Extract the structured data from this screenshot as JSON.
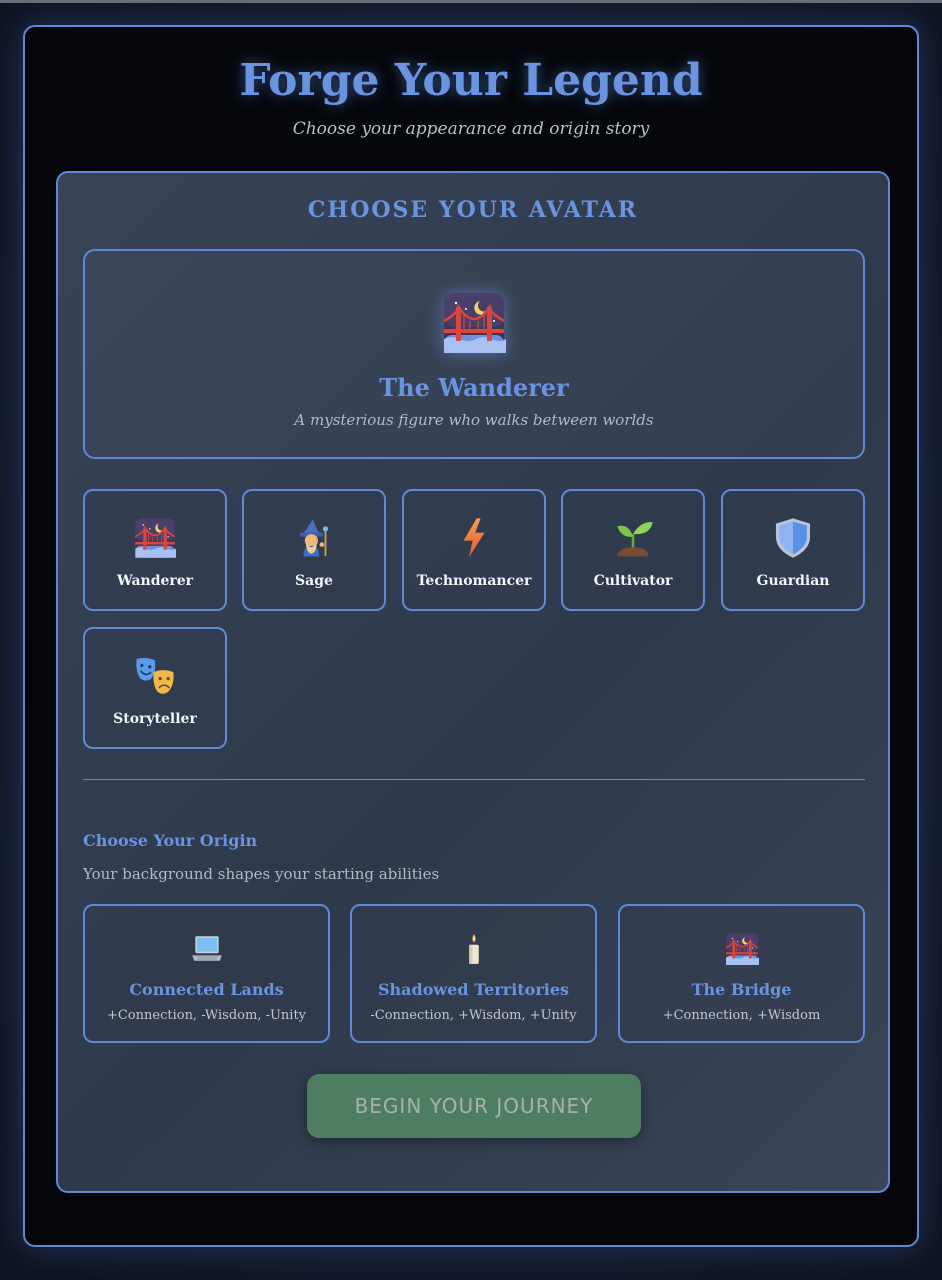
{
  "header": {
    "title": "Forge Your Legend",
    "subtitle": "Choose your appearance and origin story"
  },
  "avatar_section": {
    "heading": "CHOOSE YOUR AVATAR",
    "selected": {
      "name": "The Wanderer",
      "description": "A mysterious figure who walks between worlds",
      "icon": "bridge-at-night-icon"
    },
    "avatars": [
      {
        "label": "Wanderer",
        "icon": "bridge-at-night-icon"
      },
      {
        "label": "Sage",
        "icon": "mage-icon"
      },
      {
        "label": "Technomancer",
        "icon": "lightning-icon"
      },
      {
        "label": "Cultivator",
        "icon": "seedling-icon"
      },
      {
        "label": "Guardian",
        "icon": "shield-icon"
      },
      {
        "label": "Storyteller",
        "icon": "theater-masks-icon"
      }
    ]
  },
  "origin_section": {
    "heading": "Choose Your Origin",
    "subheading": "Your background shapes your starting abilities",
    "origins": [
      {
        "name": "Connected Lands",
        "stats": "+Connection, -Wisdom, -Unity",
        "icon": "laptop-icon"
      },
      {
        "name": "Shadowed Territories",
        "stats": "-Connection, +Wisdom, +Unity",
        "icon": "candle-icon"
      },
      {
        "name": "The Bridge",
        "stats": "+Connection, +Wisdom",
        "icon": "bridge-at-night-icon"
      }
    ]
  },
  "actions": {
    "begin_label": "BEGIN YOUR JOURNEY"
  },
  "colors": {
    "accent": "#6b94e0",
    "border": "#5f89d8",
    "button": "#4f7d62"
  }
}
